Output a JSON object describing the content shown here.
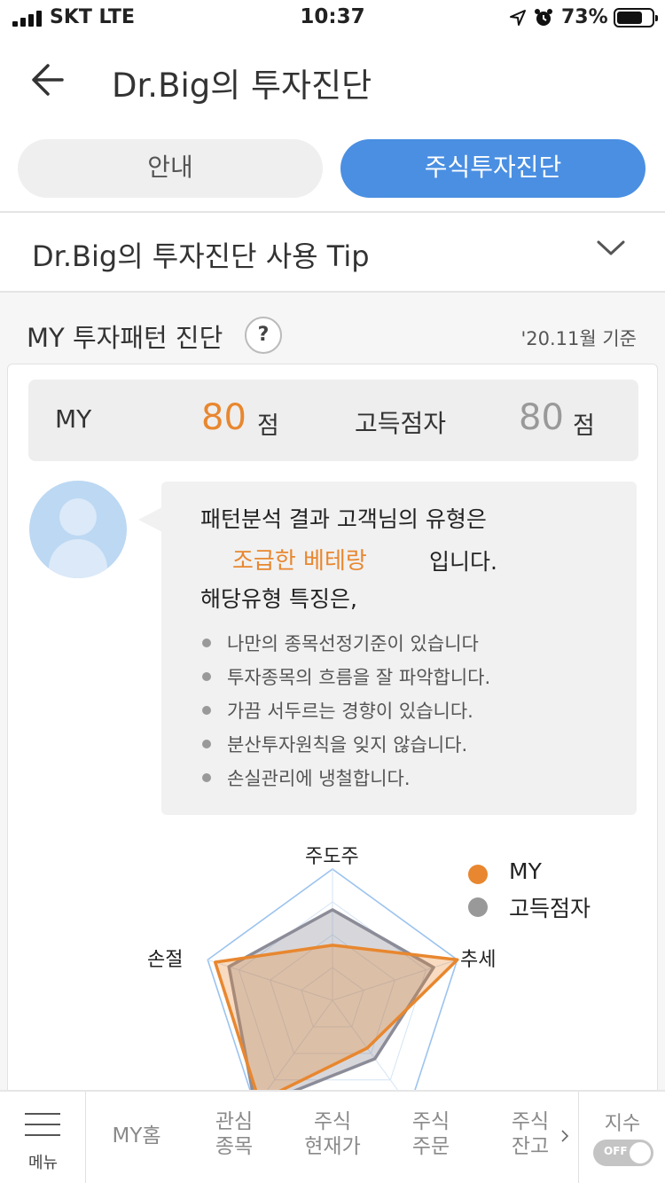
{
  "status_bar": {
    "carrier": "SKT  LTE",
    "time": "10:37",
    "battery_percent": "73%",
    "icons": [
      "signal-icon",
      "location-arrow-icon",
      "alarm-icon",
      "battery-icon"
    ]
  },
  "header": {
    "title": "Dr.Big의 투자진단",
    "back_icon": "back-arrow-icon"
  },
  "tabs": [
    {
      "label": "안내",
      "active": false
    },
    {
      "label": "주식투자진단",
      "active": true
    }
  ],
  "tip": {
    "title": "Dr.Big의 투자진단 사용 Tip",
    "icon": "chevron-down-icon"
  },
  "section": {
    "title": "MY 투자패턴 진단",
    "help": "?",
    "as_of": "'20.11월 기준"
  },
  "score": {
    "my_label": "MY",
    "my_value": "80",
    "my_unit": "점",
    "top_label": "고득점자",
    "top_value": "80",
    "top_unit": "점"
  },
  "diagnosis": {
    "line1": "패턴분석 결과 고객님의 유형은",
    "type": "조급한 베테랑",
    "suffix": "입니다.",
    "line3": "해당유형 특징은,",
    "traits": [
      "나만의 종목선정기준이 있습니다",
      "투자종목의 흐름을 잘 파악합니다.",
      "가끔 서두르는 경향이 있습니다.",
      "분산투자원칙을 잊지 않습니다.",
      "손실관리에 냉철합니다."
    ]
  },
  "chart_data": {
    "type": "radar",
    "axes": [
      "주도주",
      "추세",
      "",
      "",
      "손절"
    ],
    "series": [
      {
        "name": "MY",
        "color": "#e8872f",
        "values": [
          0.42,
          1.0,
          0.45,
          0.95,
          0.94
        ]
      },
      {
        "name": "고득점자",
        "color": "#999999",
        "values": [
          0.69,
          0.81,
          0.55,
          1.0,
          0.83
        ]
      }
    ],
    "grid_levels": 4,
    "legend": [
      "MY",
      "고득점자"
    ],
    "legend_position": "top-right"
  },
  "bottom_nav": {
    "menu_label": "메뉴",
    "items": [
      {
        "line1": "MY홈",
        "line2": ""
      },
      {
        "line1": "관심",
        "line2": "종목"
      },
      {
        "line1": "주식",
        "line2": "현재가"
      },
      {
        "line1": "주식",
        "line2": "주문"
      },
      {
        "line1": "주식",
        "line2": "잔고"
      }
    ],
    "index_label": "지수",
    "toggle_text": "OFF"
  },
  "colors": {
    "accent_blue": "#4a8fe2",
    "accent_orange": "#e8872f",
    "muted_gray": "#999999"
  }
}
